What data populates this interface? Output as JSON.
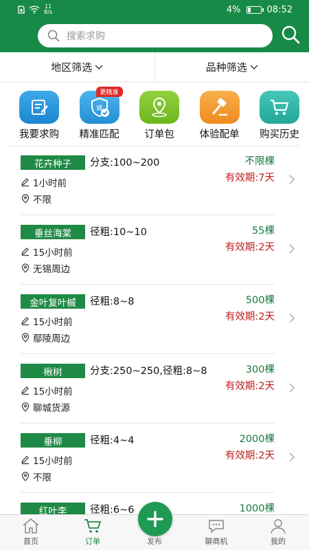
{
  "status": {
    "speed_value": "11",
    "speed_unit": "B/s",
    "battery": "4%",
    "time": "08:52"
  },
  "search": {
    "placeholder": "搜索求购"
  },
  "filters": {
    "region": "地区筛选",
    "variety": "品种筛选"
  },
  "quick_actions": [
    {
      "label": "我要求购",
      "icon": "edit-icon",
      "color": "#1e90d8"
    },
    {
      "label": "精准匹配",
      "icon": "shield-check-icon",
      "color": "#29a0e0",
      "badge": "更精准"
    },
    {
      "label": "订单包",
      "icon": "location-pin-icon",
      "color": "#7cc02a"
    },
    {
      "label": "体验配单",
      "icon": "hammer-icon",
      "color": "#f39a2d"
    },
    {
      "label": "购买历史",
      "icon": "cart-icon",
      "color": "#2bb6a8"
    }
  ],
  "listings": [
    {
      "tag": "花卉种子",
      "spec": "分支:100~200",
      "quantity": "不限棵",
      "validity": "有效期:7天",
      "time": "1小时前",
      "location": "不限"
    },
    {
      "tag": "垂丝海棠",
      "spec": "径粗:10~10",
      "quantity": "55棵",
      "validity": "有效期:2天",
      "time": "15小时前",
      "location": "无锡周边"
    },
    {
      "tag": "金叶复叶槭",
      "spec": "径粗:8~8",
      "quantity": "500棵",
      "validity": "有效期:2天",
      "time": "15小时前",
      "location": "鄢陵周边"
    },
    {
      "tag": "楸树",
      "spec": "分支:250~250,径粗:8~8",
      "quantity": "300棵",
      "validity": "有效期:2天",
      "time": "15小时前",
      "location": "聊城货源"
    },
    {
      "tag": "垂柳",
      "spec": "径粗:4~4",
      "quantity": "2000棵",
      "validity": "有效期:2天",
      "time": "15小时前",
      "location": "不限"
    },
    {
      "tag": "红叶李",
      "spec": "径粗:6~6",
      "quantity": "1000棵",
      "validity": "",
      "time": "",
      "location": ""
    }
  ],
  "tabbar": {
    "home": "首页",
    "orders": "订单",
    "publish": "发布",
    "chat": "聊商机",
    "mine": "我的"
  },
  "colors": {
    "brand_green": "#188a47",
    "validity_red": "#c21d1d",
    "qty_green": "#177a3f"
  }
}
